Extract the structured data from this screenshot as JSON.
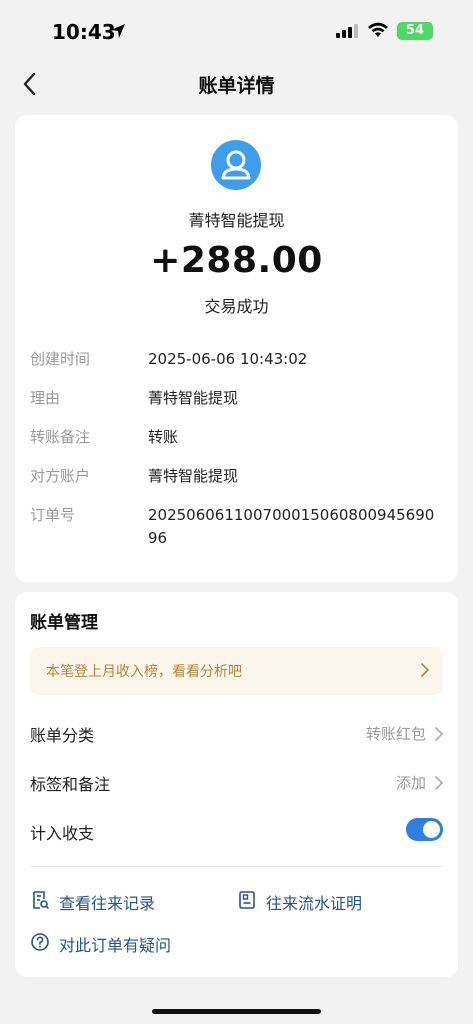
{
  "status_bar": {
    "time": "10:43",
    "battery": "54"
  },
  "nav": {
    "title": "账单详情"
  },
  "bill": {
    "payee": "菁特智能提现",
    "amount": "+288.00",
    "status": "交易成功",
    "details": [
      {
        "label": "创建时间",
        "value": "2025-06-06 10:43:02"
      },
      {
        "label": "理由",
        "value": "菁特智能提现"
      },
      {
        "label": "转账备注",
        "value": "转账"
      },
      {
        "label": "对方账户",
        "value": "菁特智能提现"
      },
      {
        "label": "订单号",
        "value": "20250606110070001506080094569096"
      }
    ]
  },
  "management": {
    "title": "账单管理",
    "promo": "本笔登上月收入榜，看看分析吧",
    "category": {
      "label": "账单分类",
      "value": "转账红包"
    },
    "tags": {
      "label": "标签和备注",
      "value": "添加"
    },
    "count_toggle": {
      "label": "计入收支",
      "on": true
    },
    "links": {
      "records": "查看往来记录",
      "certificate": "往来流水证明",
      "question": "对此订单有疑问"
    }
  },
  "colors": {
    "accent": "#2f7fe0",
    "link": "#22558f",
    "promo_text": "#b8843a",
    "promo_bg": "#fbf6eb",
    "avatar": "#3d9ef0"
  }
}
